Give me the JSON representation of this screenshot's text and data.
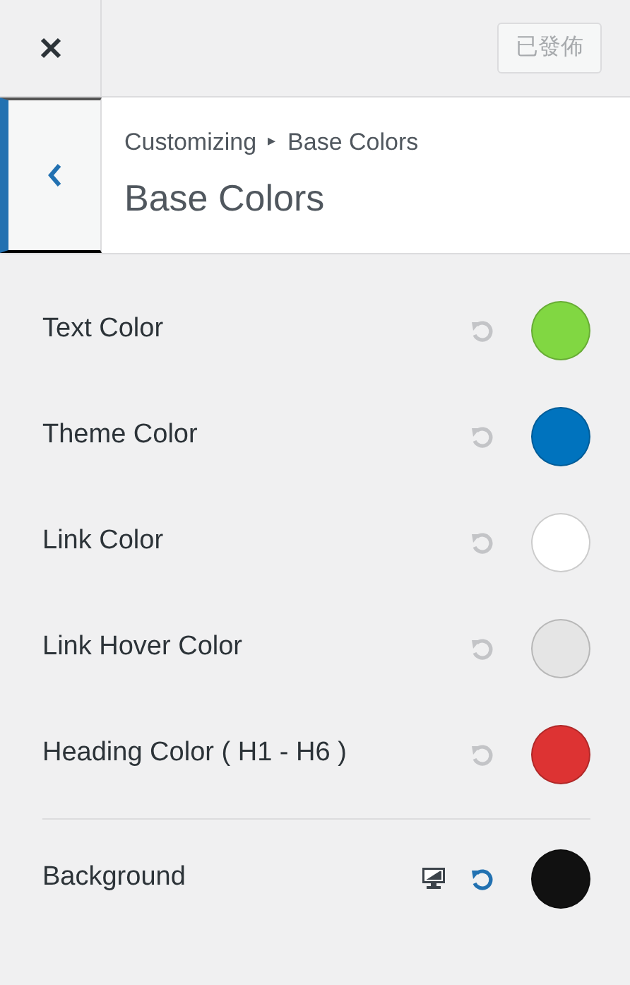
{
  "top_bar": {
    "publish_button": {
      "label": "已發佈",
      "disabled": true
    }
  },
  "header": {
    "breadcrumb": {
      "parent": "Customizing",
      "separator": "▸",
      "current": "Base Colors"
    },
    "title": "Base Colors"
  },
  "controls": [
    {
      "kind": "color",
      "label": "Text Color",
      "color": "#81d742",
      "reset_disabled": true
    },
    {
      "kind": "color",
      "label": "Theme Color",
      "color": "#0073be",
      "reset_disabled": true
    },
    {
      "kind": "color",
      "label": "Link Color",
      "color": "#ffffff",
      "reset_disabled": true
    },
    {
      "kind": "color",
      "label": "Link Hover Color",
      "color": "#e5e5e5",
      "reset_disabled": true
    },
    {
      "kind": "color",
      "label": "Heading Color ( H1 - H6 )",
      "color": "#dd3333",
      "reset_disabled": true
    },
    {
      "kind": "responsive",
      "label": "Background",
      "color": "#111111",
      "reset_disabled": false
    }
  ]
}
